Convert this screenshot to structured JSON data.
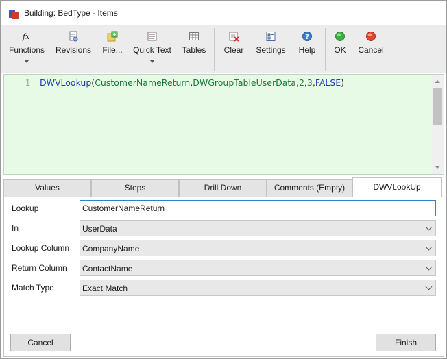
{
  "window": {
    "title": "Building: BedType - Items"
  },
  "toolbar": {
    "functions_label": "Functions",
    "revisions_label": "Revisions",
    "file_label": "File...",
    "quick_text_label": "Quick Text",
    "tables_label": "Tables",
    "clear_label": "Clear",
    "settings_label": "Settings",
    "help_label": "Help",
    "ok_label": "OK",
    "cancel_label": "Cancel",
    "icons": [
      "function-icon",
      "revisions-icon",
      "file-icon",
      "quick-text-icon",
      "tables-icon",
      "clear-icon",
      "settings-icon",
      "help-icon",
      "ok-icon",
      "cancel-icon"
    ],
    "ok_color": "#3cb043",
    "cancel_color": "#e0452e"
  },
  "editor": {
    "line_number": "1",
    "code": {
      "function": "DWVLookup",
      "open": "(",
      "arg1": "CustomerNameReturn",
      "comma1": ",",
      "arg2": "DWGroupTableUserData",
      "comma2": ",",
      "arg3": "2",
      "comma3": ",",
      "arg4": "3",
      "comma4": ",",
      "arg5": "FALSE",
      "close": ")"
    },
    "background": "#e6fae6"
  },
  "tabs": [
    {
      "label": "Values"
    },
    {
      "label": "Steps"
    },
    {
      "label": "Drill Down"
    },
    {
      "label": "Comments (Empty)"
    },
    {
      "label": "DWVLookUp",
      "active": true
    }
  ],
  "form": {
    "lookup": {
      "label": "Lookup",
      "value": "CustomerNameReturn"
    },
    "in": {
      "label": "In",
      "value": "UserData"
    },
    "lookup_column": {
      "label": "Lookup Column",
      "value": "CompanyName"
    },
    "return_column": {
      "label": "Return Column",
      "value": "ContactName"
    },
    "match_type": {
      "label": "Match Type",
      "value": "Exact Match"
    }
  },
  "buttons": {
    "cancel": "Cancel",
    "finish": "Finish"
  }
}
